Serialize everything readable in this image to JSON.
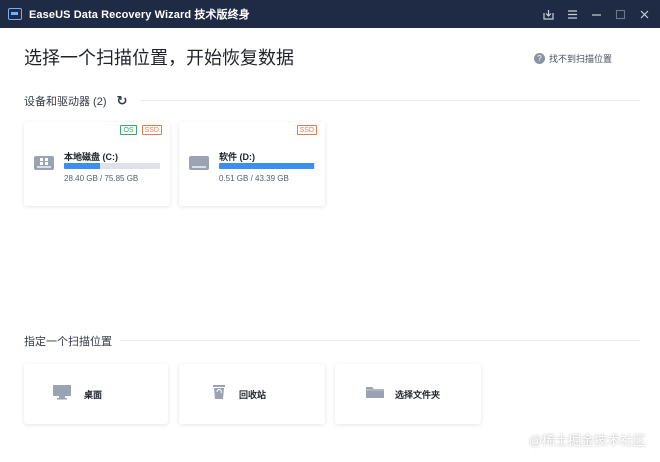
{
  "titlebar": {
    "title": "EaseUS Data Recovery Wizard 技术版终身",
    "controls": [
      "export-icon",
      "menu-icon",
      "minimize-icon",
      "maximize-icon",
      "close-icon"
    ]
  },
  "header": {
    "title": "选择一个扫描位置，开始恢复数据",
    "help_label": "找不到扫描位置",
    "help_icon": "?"
  },
  "devices": {
    "section_label": "设备和驱动器 (2)",
    "drives": [
      {
        "name": "本地磁盘 (C:)",
        "size": "28.40 GB / 75.85 GB",
        "used_fraction": 0.374,
        "badges": [
          "OS",
          "SSD"
        ]
      },
      {
        "name": "软件 (D:)",
        "size": "0.51 GB / 43.39 GB",
        "used_fraction": 0.99,
        "badges": [
          "SSD"
        ]
      }
    ]
  },
  "locations": {
    "section_label": "指定一个扫描位置",
    "items": [
      {
        "label": "桌面",
        "icon": "desktop-icon"
      },
      {
        "label": "回收站",
        "icon": "recycle-bin-icon"
      },
      {
        "label": "选择文件夹",
        "icon": "folder-icon"
      }
    ]
  },
  "watermark": "@稀土掘金技术社区",
  "colors": {
    "titlebar": "#1f2a44",
    "accent": "#3a8ff0",
    "badge_os": "#3aa86a",
    "badge_ssd": "#e07b4f"
  }
}
